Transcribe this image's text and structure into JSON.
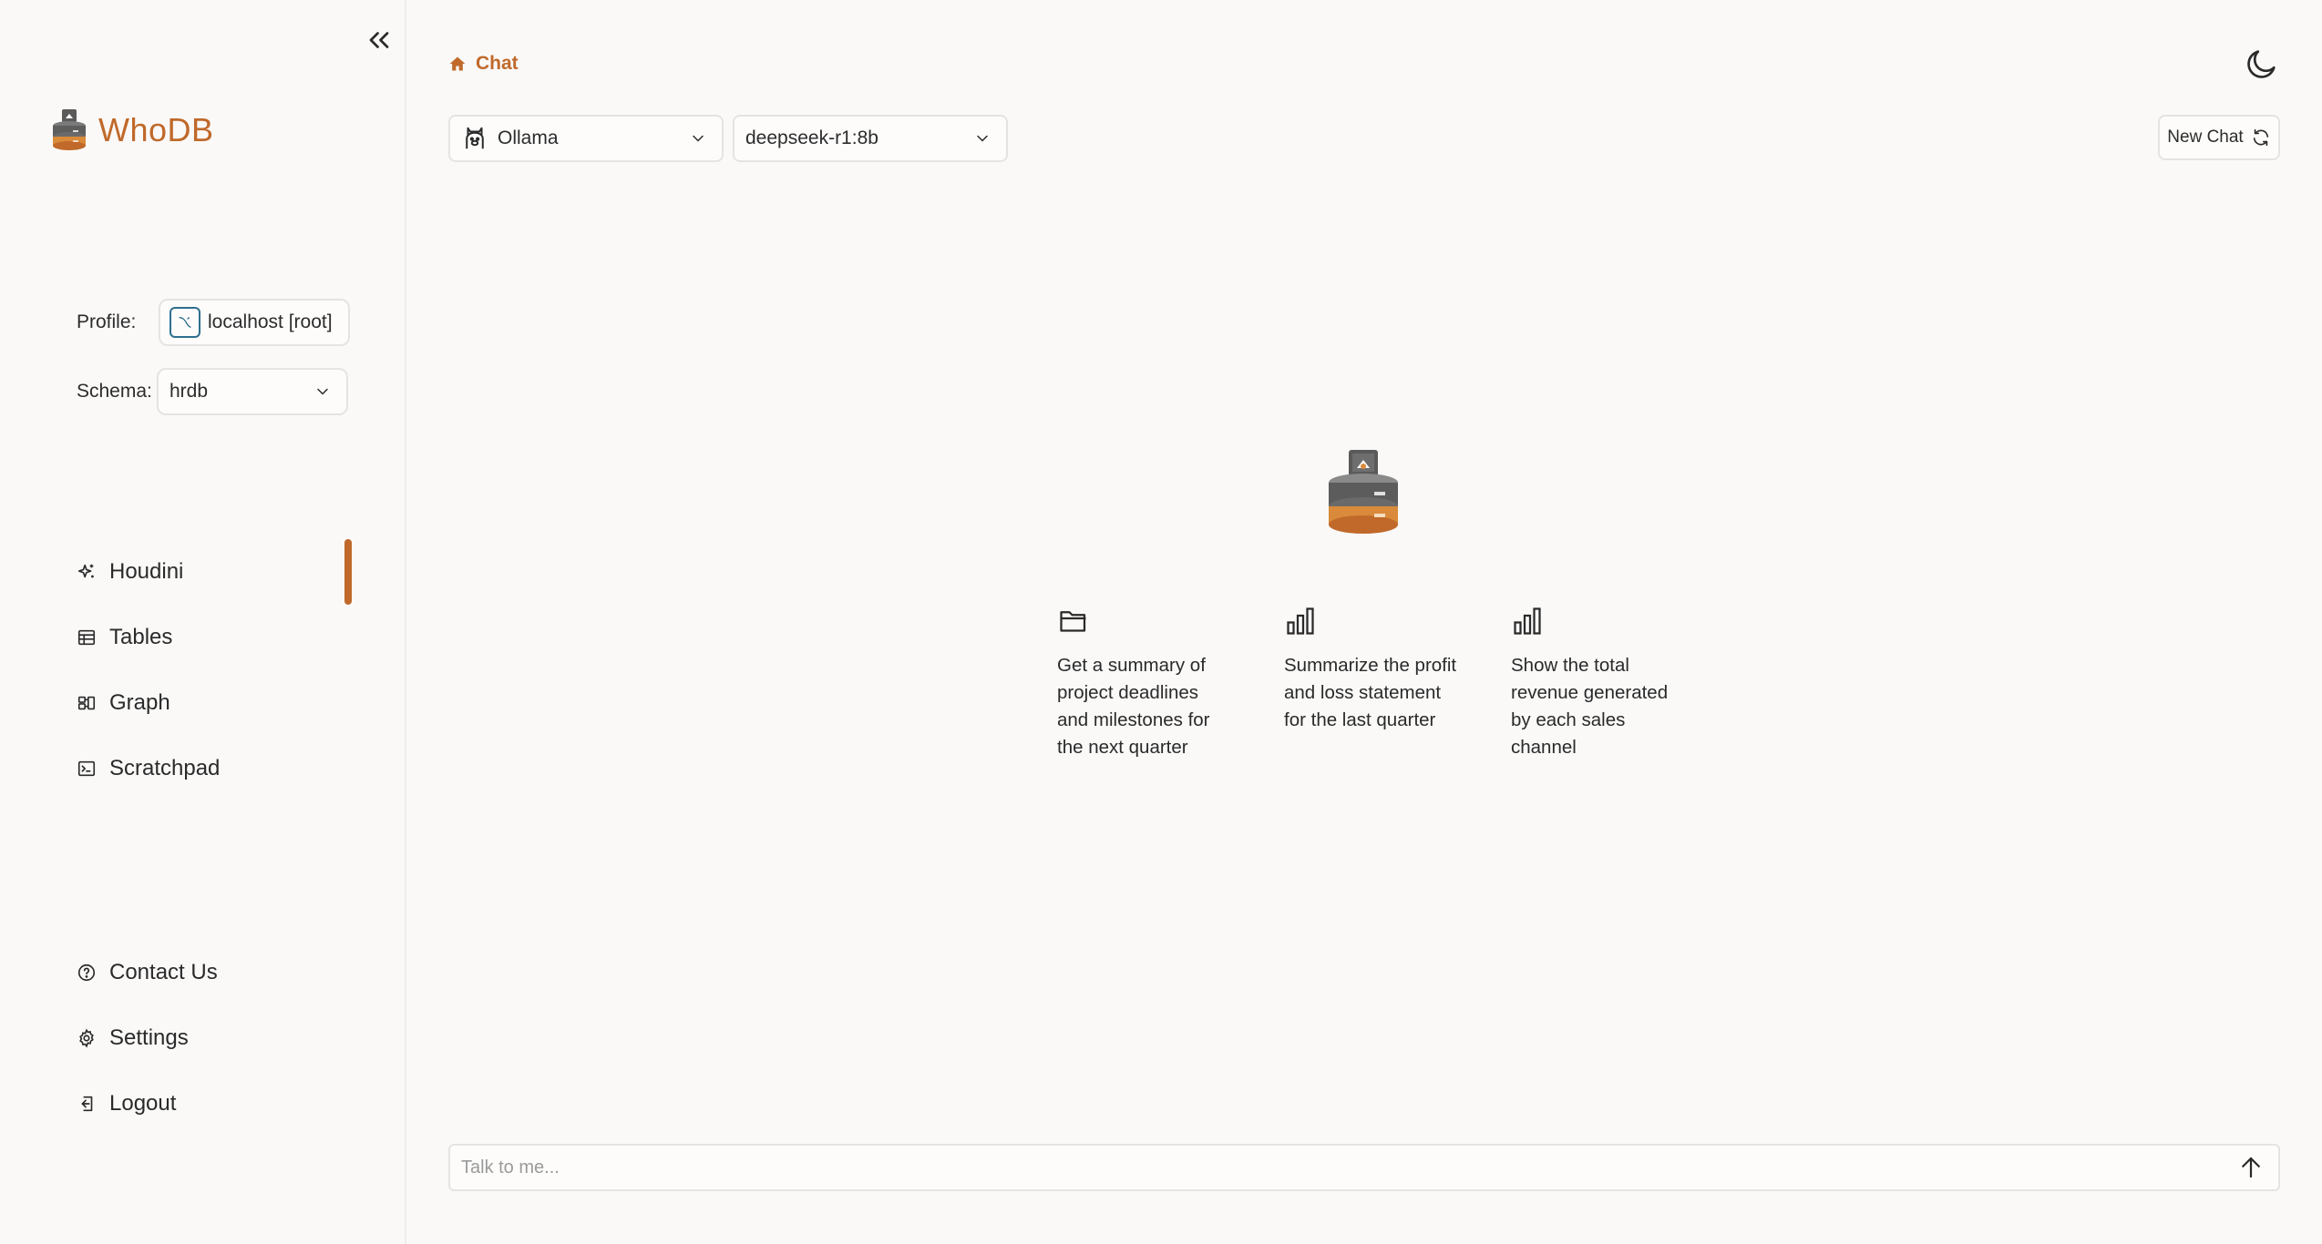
{
  "sidebar": {
    "brand_name": "WhoDB",
    "profile_label": "Profile:",
    "profile_value": "localhost [root]",
    "schema_label": "Schema:",
    "schema_value": "hrdb",
    "nav_items": [
      {
        "label": "Houdini",
        "icon": "sparkles-icon",
        "active": true
      },
      {
        "label": "Tables",
        "icon": "table-icon"
      },
      {
        "label": "Graph",
        "icon": "graph-icon"
      },
      {
        "label": "Scratchpad",
        "icon": "terminal-icon"
      }
    ],
    "footer_items": [
      {
        "label": "Contact Us",
        "icon": "help-circle-icon"
      },
      {
        "label": "Settings",
        "icon": "gear-icon"
      },
      {
        "label": "Logout",
        "icon": "logout-icon"
      }
    ]
  },
  "header": {
    "breadcrumb": "Chat"
  },
  "toolbar": {
    "provider": "Ollama",
    "model": "deepseek-r1:8b",
    "new_chat_label": "New Chat"
  },
  "suggestions": [
    {
      "icon": "folder-icon",
      "text": "Get a summary of project deadlines and milestones for the next quarter"
    },
    {
      "icon": "bar-chart-icon",
      "text": "Summarize the profit and loss statement for the last quarter"
    },
    {
      "icon": "bar-chart-icon",
      "text": "Show the total revenue generated by each sales channel"
    }
  ],
  "chat": {
    "placeholder": "Talk to me..."
  },
  "colors": {
    "accent": "#c0692a",
    "background": "#faf9f8"
  }
}
